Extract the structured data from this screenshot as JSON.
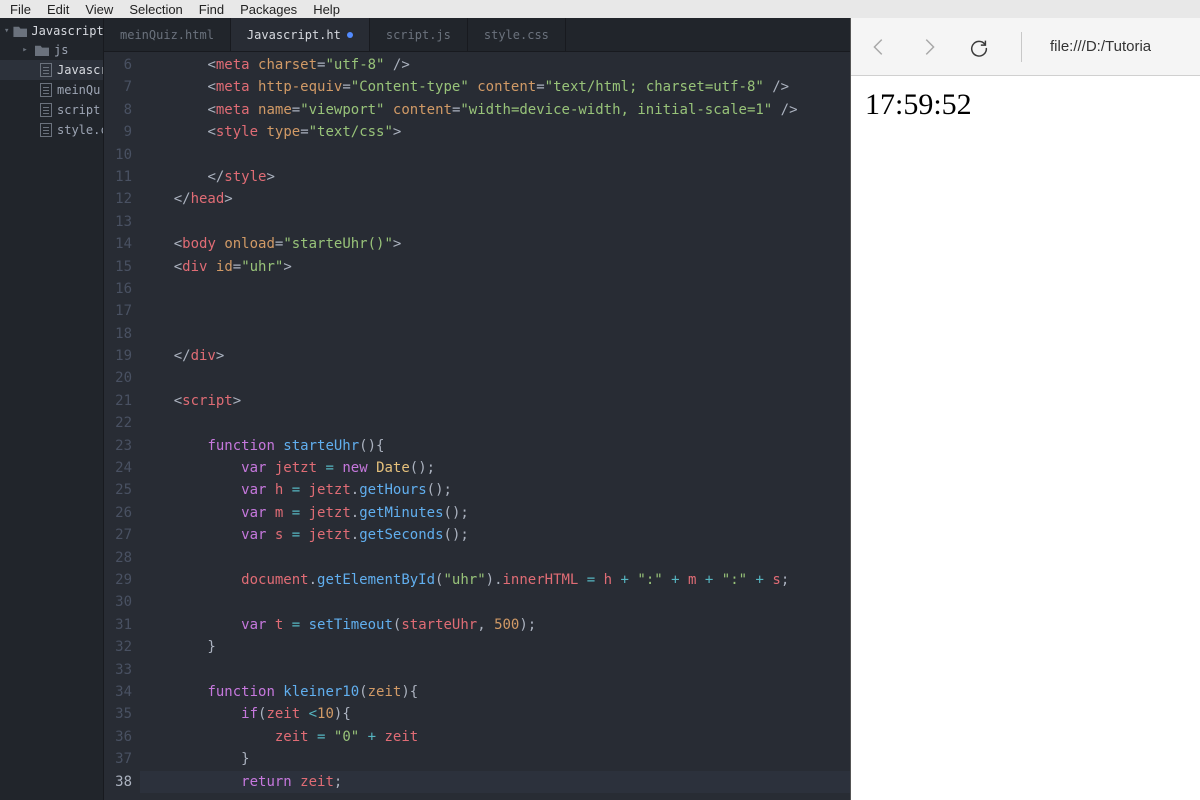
{
  "menu": [
    "File",
    "Edit",
    "View",
    "Selection",
    "Find",
    "Packages",
    "Help"
  ],
  "project": {
    "root": "Javascript P",
    "folder": "js",
    "files": [
      "Javascri",
      "meinQu",
      "script.js",
      "style.css"
    ]
  },
  "tabs": [
    {
      "label": "meinQuiz.html",
      "active": false,
      "dirty": false
    },
    {
      "label": "Javascript.ht",
      "active": true,
      "dirty": true
    },
    {
      "label": "script.js",
      "active": false,
      "dirty": false
    },
    {
      "label": "style.css",
      "active": false,
      "dirty": false
    }
  ],
  "code": {
    "first_line": 6,
    "highlight_line": 38,
    "lines": [
      [
        [
          "        "
        ],
        [
          "<",
          "p"
        ],
        [
          "meta",
          "t"
        ],
        [
          " "
        ],
        [
          "charset",
          "a"
        ],
        [
          "="
        ],
        [
          "\"utf-8\"",
          "s"
        ],
        [
          " />",
          "p"
        ]
      ],
      [
        [
          "        "
        ],
        [
          "<",
          "p"
        ],
        [
          "meta",
          "t"
        ],
        [
          " "
        ],
        [
          "http-equiv",
          "a"
        ],
        [
          "="
        ],
        [
          "\"Content-type\"",
          "s"
        ],
        [
          " "
        ],
        [
          "content",
          "a"
        ],
        [
          "="
        ],
        [
          "\"text/html; charset=utf-8\"",
          "s"
        ],
        [
          " />",
          "p"
        ]
      ],
      [
        [
          "        "
        ],
        [
          "<",
          "p"
        ],
        [
          "meta",
          "t"
        ],
        [
          " "
        ],
        [
          "name",
          "a"
        ],
        [
          "="
        ],
        [
          "\"viewport\"",
          "s"
        ],
        [
          " "
        ],
        [
          "content",
          "a"
        ],
        [
          "="
        ],
        [
          "\"width=device-width, initial-scale=1\"",
          "s"
        ],
        [
          " />",
          "p"
        ]
      ],
      [
        [
          "        "
        ],
        [
          "<",
          "p"
        ],
        [
          "style",
          "t"
        ],
        [
          " "
        ],
        [
          "type",
          "a"
        ],
        [
          "="
        ],
        [
          "\"text/css\"",
          "s"
        ],
        [
          ">",
          "p"
        ]
      ],
      [
        [
          ""
        ]
      ],
      [
        [
          "        "
        ],
        [
          "</",
          "p"
        ],
        [
          "style",
          "t"
        ],
        [
          ">",
          "p"
        ]
      ],
      [
        [
          "    "
        ],
        [
          "</",
          "p"
        ],
        [
          "head",
          "t"
        ],
        [
          ">",
          "p"
        ]
      ],
      [
        [
          ""
        ]
      ],
      [
        [
          "    "
        ],
        [
          "<",
          "p"
        ],
        [
          "body",
          "t"
        ],
        [
          " "
        ],
        [
          "onload",
          "a"
        ],
        [
          "="
        ],
        [
          "\"starteUhr()\"",
          "s"
        ],
        [
          ">",
          "p"
        ]
      ],
      [
        [
          "    "
        ],
        [
          "<",
          "p"
        ],
        [
          "div",
          "t"
        ],
        [
          " "
        ],
        [
          "id",
          "a"
        ],
        [
          "="
        ],
        [
          "\"uhr\"",
          "s"
        ],
        [
          ">",
          "p"
        ]
      ],
      [
        [
          ""
        ]
      ],
      [
        [
          ""
        ]
      ],
      [
        [
          ""
        ]
      ],
      [
        [
          "    "
        ],
        [
          "</",
          "p"
        ],
        [
          "div",
          "t"
        ],
        [
          ">",
          "p"
        ]
      ],
      [
        [
          ""
        ]
      ],
      [
        [
          "    "
        ],
        [
          "<",
          "p"
        ],
        [
          "script",
          "t"
        ],
        [
          ">",
          "p"
        ]
      ],
      [
        [
          ""
        ]
      ],
      [
        [
          "        "
        ],
        [
          "function ",
          "k"
        ],
        [
          "starteUhr",
          "f"
        ],
        [
          "(){",
          "p"
        ]
      ],
      [
        [
          "            "
        ],
        [
          "var ",
          "k"
        ],
        [
          "jetzt",
          "v"
        ],
        [
          " ",
          "p"
        ],
        [
          "=",
          "o"
        ],
        [
          " "
        ],
        [
          "new ",
          "k"
        ],
        [
          "Date",
          "id"
        ],
        [
          "();",
          "p"
        ]
      ],
      [
        [
          "            "
        ],
        [
          "var ",
          "k"
        ],
        [
          "h",
          "v"
        ],
        [
          " ",
          "p"
        ],
        [
          "=",
          "o"
        ],
        [
          " "
        ],
        [
          "jetzt",
          "v"
        ],
        [
          ".",
          "p"
        ],
        [
          "getHours",
          "f"
        ],
        [
          "();",
          "p"
        ]
      ],
      [
        [
          "            "
        ],
        [
          "var ",
          "k"
        ],
        [
          "m",
          "v"
        ],
        [
          " ",
          "p"
        ],
        [
          "=",
          "o"
        ],
        [
          " "
        ],
        [
          "jetzt",
          "v"
        ],
        [
          ".",
          "p"
        ],
        [
          "getMinutes",
          "f"
        ],
        [
          "();",
          "p"
        ]
      ],
      [
        [
          "            "
        ],
        [
          "var ",
          "k"
        ],
        [
          "s",
          "v"
        ],
        [
          " ",
          "p"
        ],
        [
          "=",
          "o"
        ],
        [
          " "
        ],
        [
          "jetzt",
          "v"
        ],
        [
          ".",
          "p"
        ],
        [
          "getSeconds",
          "f"
        ],
        [
          "();",
          "p"
        ]
      ],
      [
        [
          ""
        ]
      ],
      [
        [
          "            "
        ],
        [
          "document",
          "v"
        ],
        [
          ".",
          "p"
        ],
        [
          "getElementById",
          "f"
        ],
        [
          "(",
          "p"
        ],
        [
          "\"uhr\"",
          "s"
        ],
        [
          ").",
          "p"
        ],
        [
          "innerHTML",
          "t"
        ],
        [
          " ",
          "p"
        ],
        [
          "=",
          "o"
        ],
        [
          " "
        ],
        [
          "h",
          "v"
        ],
        [
          " ",
          "p"
        ],
        [
          "+",
          "o"
        ],
        [
          " "
        ],
        [
          "\":\"",
          "s"
        ],
        [
          " ",
          "p"
        ],
        [
          "+",
          "o"
        ],
        [
          " "
        ],
        [
          "m",
          "v"
        ],
        [
          " ",
          "p"
        ],
        [
          "+",
          "o"
        ],
        [
          " "
        ],
        [
          "\":\"",
          "s"
        ],
        [
          " ",
          "p"
        ],
        [
          "+",
          "o"
        ],
        [
          " "
        ],
        [
          "s",
          "v"
        ],
        [
          ";",
          "p"
        ]
      ],
      [
        [
          ""
        ]
      ],
      [
        [
          "            "
        ],
        [
          "var ",
          "k"
        ],
        [
          "t",
          "v"
        ],
        [
          " ",
          "p"
        ],
        [
          "=",
          "o"
        ],
        [
          " "
        ],
        [
          "setTimeout",
          "f"
        ],
        [
          "(",
          "p"
        ],
        [
          "starteUhr",
          "v"
        ],
        [
          ", ",
          "p"
        ],
        [
          "500",
          "n"
        ],
        [
          ");",
          "p"
        ]
      ],
      [
        [
          "        }",
          "p"
        ]
      ],
      [
        [
          ""
        ]
      ],
      [
        [
          "        "
        ],
        [
          "function ",
          "k"
        ],
        [
          "kleiner10",
          "f"
        ],
        [
          "(",
          "p"
        ],
        [
          "zeit",
          "a"
        ],
        [
          "){",
          "p"
        ]
      ],
      [
        [
          "            "
        ],
        [
          "if",
          "k"
        ],
        [
          "(",
          "p"
        ],
        [
          "zeit",
          "v"
        ],
        [
          " ",
          "p"
        ],
        [
          "<",
          "o"
        ],
        [
          "10",
          "n"
        ],
        [
          "){",
          "p"
        ]
      ],
      [
        [
          "                "
        ],
        [
          "zeit",
          "v"
        ],
        [
          " ",
          "p"
        ],
        [
          "=",
          "o"
        ],
        [
          " "
        ],
        [
          "\"0\"",
          "s"
        ],
        [
          " ",
          "p"
        ],
        [
          "+",
          "o"
        ],
        [
          " "
        ],
        [
          "zeit",
          "v"
        ]
      ],
      [
        [
          "            }",
          "p"
        ]
      ],
      [
        [
          "            "
        ],
        [
          "return ",
          "k"
        ],
        [
          "zeit",
          "v"
        ],
        [
          ";",
          "p"
        ]
      ]
    ]
  },
  "browser": {
    "url": "file:///D:/Tutoria",
    "clock": "17:59:52"
  }
}
